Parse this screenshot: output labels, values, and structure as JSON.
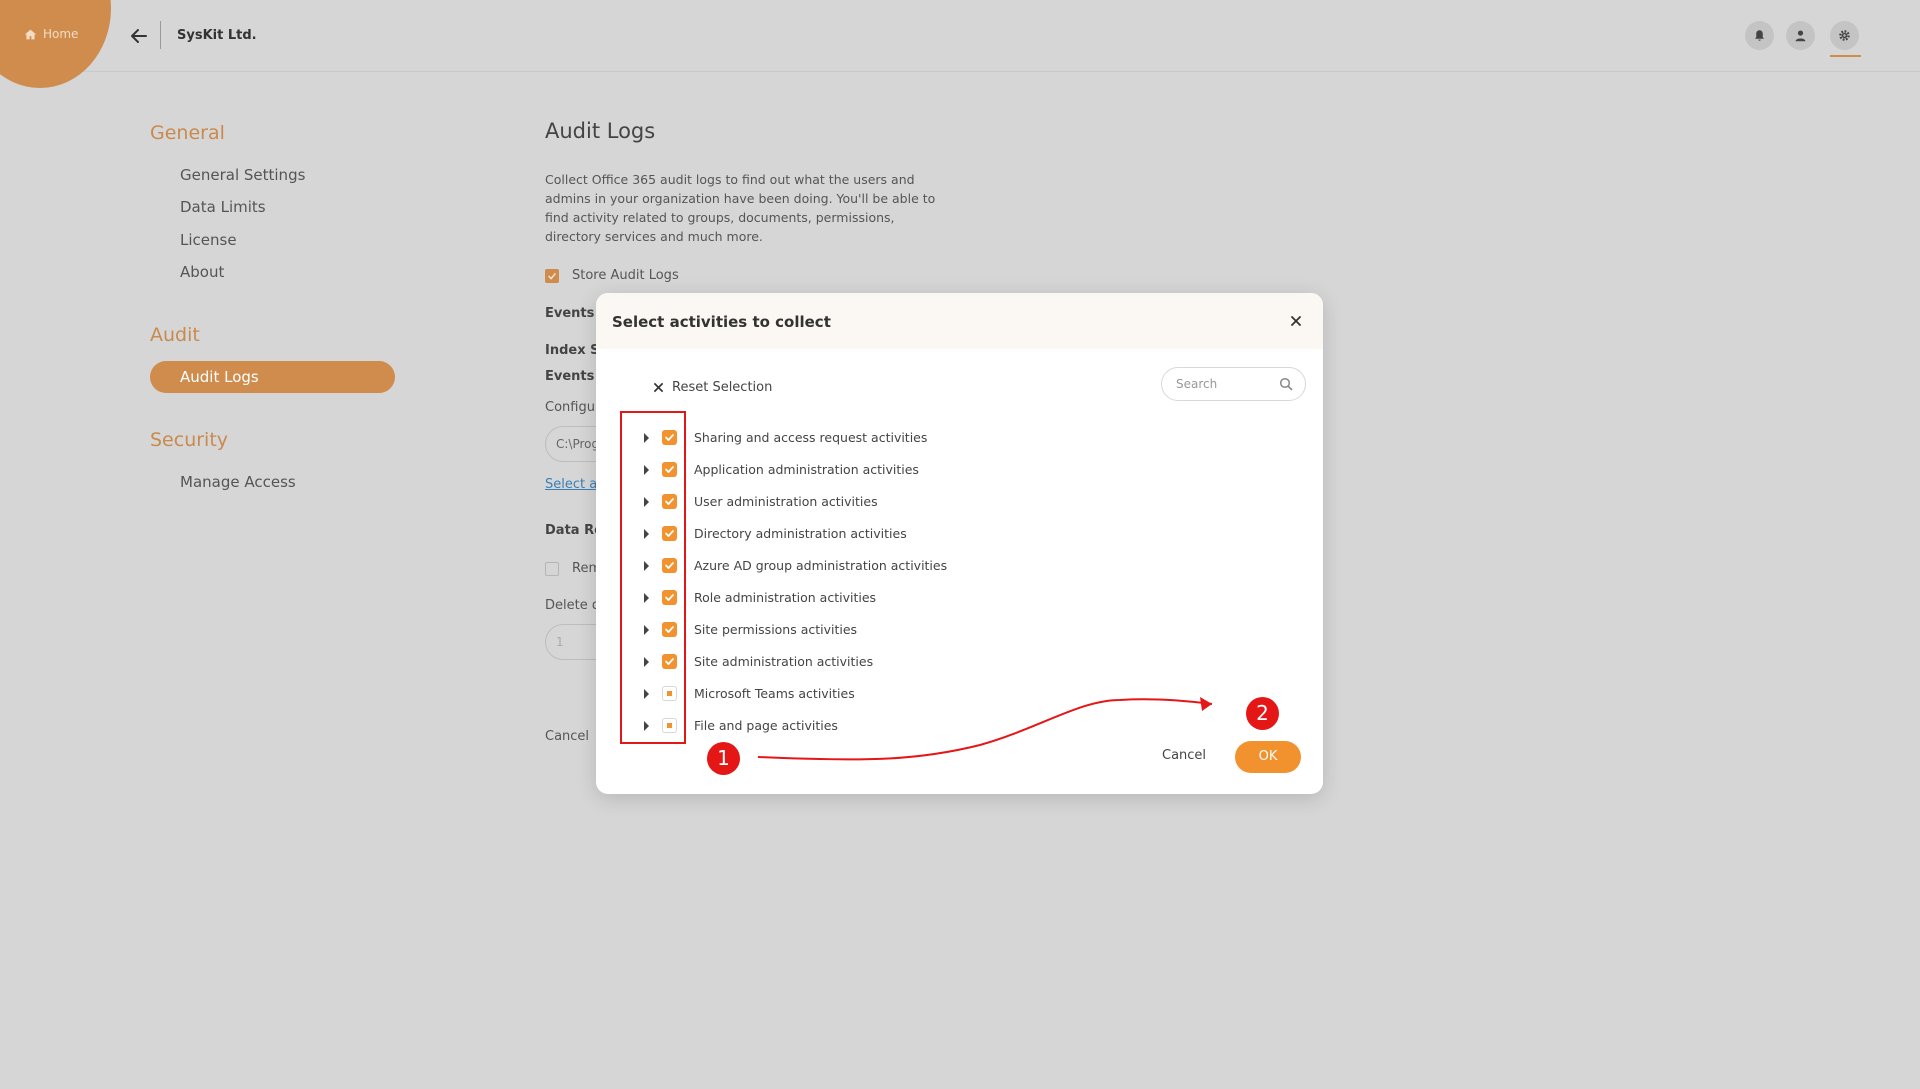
{
  "topbar": {
    "home_label": "Home",
    "org_name": "SysKit Ltd."
  },
  "nav": {
    "general_title": "General",
    "general_items": [
      "General Settings",
      "Data Limits",
      "License",
      "About"
    ],
    "audit_title": "Audit",
    "audit_active": "Audit Logs",
    "security_title": "Security",
    "security_items": [
      "Manage Access"
    ]
  },
  "page": {
    "title": "Audit Logs",
    "description": "Collect Office 365 audit logs to find out what the users and admins in your organization have been doing. You'll be able to find activity related to groups, documents, permissions, directory services and much more.",
    "store_label": "Store Audit Logs",
    "events_heading": "Events i",
    "index_label": "Index Si",
    "events_in": "Events in",
    "config_label": "Configur",
    "path_value": "C:\\Prog",
    "select_link": "Select ac",
    "data_heading": "Data Re",
    "remove_label": "Rem",
    "delete_label": "Delete d",
    "number_value": "1",
    "cancel_label": "Cancel"
  },
  "modal": {
    "title": "Select activities to collect",
    "reset_label": "Reset Selection",
    "search_placeholder": "Search",
    "activities": [
      {
        "label": "Sharing and access request activities",
        "state": "checked"
      },
      {
        "label": "Application administration activities",
        "state": "checked"
      },
      {
        "label": "User administration activities",
        "state": "checked"
      },
      {
        "label": "Directory administration activities",
        "state": "checked"
      },
      {
        "label": "Azure AD group administration activities",
        "state": "checked"
      },
      {
        "label": "Role administration activities",
        "state": "checked"
      },
      {
        "label": "Site permissions activities",
        "state": "checked"
      },
      {
        "label": "Site administration activities",
        "state": "checked"
      },
      {
        "label": "Microsoft Teams activities",
        "state": "partial"
      },
      {
        "label": "File and page activities",
        "state": "partial"
      }
    ],
    "cancel_label": "Cancel",
    "ok_label": "OK"
  },
  "annotations": {
    "marker_1": "1",
    "marker_2": "2"
  },
  "colors": {
    "accent": "#f2922f",
    "nav_accent": "#cf8c4d",
    "annotation": "#e51616",
    "background": "#d6d6d6"
  }
}
